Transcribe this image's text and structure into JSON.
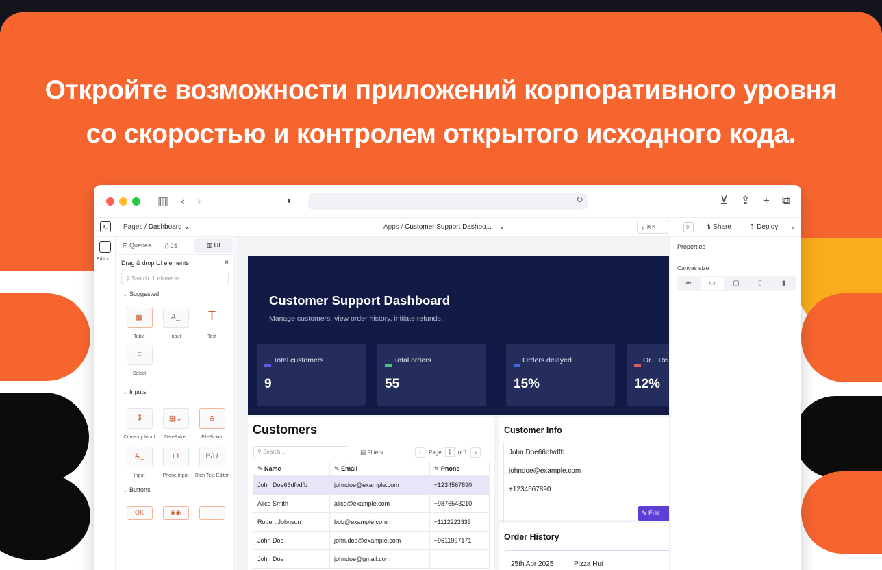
{
  "headline": {
    "line1": "Откройте возможности приложений корпоративного уровня",
    "line2": "со скоростью и контролем открытого исходного кода."
  },
  "colors": {
    "brand_orange": "#f7652f",
    "accent_purple": "#5b3fd6",
    "hero_navy": "#121a46"
  },
  "appbar": {
    "logo": "a_",
    "pages_prefix": "Pages /",
    "pages_current": "Dashboard ⌄",
    "apps_prefix": "Apps /",
    "app_name": "Customer Support Dashbo...",
    "app_chevron": "⌄",
    "search_shortcut": "⌘K",
    "run": "▷",
    "share": "Share",
    "deploy": "Deploy",
    "deploy_chevron": "⌄"
  },
  "rail": {
    "editor_label": "Editor"
  },
  "panel": {
    "tabs": {
      "queries": "Queries",
      "js": "JS",
      "ui": "UI"
    },
    "title": "Drag & drop UI elements",
    "close": "×",
    "search_placeholder": "Search UI elements",
    "sections": {
      "suggested": "Suggested",
      "inputs": "Inputs",
      "buttons": "Buttons"
    },
    "suggested": [
      {
        "label": "Table",
        "glyph": "▦"
      },
      {
        "label": "Input",
        "glyph": "A_"
      },
      {
        "label": "Text",
        "glyph": "T"
      }
    ],
    "suggested2": [
      {
        "label": "Select",
        "glyph": "≡"
      }
    ],
    "inputs": [
      {
        "label": "Currency Input",
        "glyph": "$"
      },
      {
        "label": "DatePaker",
        "glyph": "▦⌄"
      },
      {
        "label": "FilePicker",
        "glyph": "⊕"
      }
    ],
    "inputs2": [
      {
        "label": "Input",
        "glyph": "A_"
      },
      {
        "label": "Phone Input",
        "glyph": "+1"
      },
      {
        "label": "Rich Text Editor",
        "glyph": "B/U"
      }
    ],
    "buttons": [
      {
        "glyph": "OK"
      },
      {
        "glyph": "◉◉"
      },
      {
        "glyph": "+"
      }
    ]
  },
  "hero": {
    "title": "Customer Support Dashboard",
    "subtitle": "Manage customers, view order history, initiate refunds.",
    "stats": [
      {
        "label": "Total customers",
        "value": "9",
        "color": "#6a55e8"
      },
      {
        "label": "Total orders",
        "value": "55",
        "color": "#4ec27a"
      },
      {
        "label": "Orders delayed",
        "value": "15%",
        "color": "#3b6de0"
      },
      {
        "label": "Or... Re...",
        "value": "12%",
        "color": "#e25a6a"
      }
    ]
  },
  "customers": {
    "title": "Customers",
    "search_placeholder": "Search...",
    "filters": "Filters",
    "page_label": "Page",
    "page_current": "1",
    "page_of": "of 1",
    "columns": [
      "Name",
      "Email",
      "Phone"
    ],
    "rows": [
      [
        "John Doe66dfvdfb",
        "johndoe@example.com",
        "+1234567890"
      ],
      [
        "Alice Smith",
        "alice@example.com",
        "+9876543210"
      ],
      [
        "Robert Johnson",
        "bob@example.com",
        "+1112223333"
      ],
      [
        "John Doe",
        "john.doe@example.com",
        "+9611997171"
      ],
      [
        "John Doe",
        "johndoe@gmail.com",
        ""
      ]
    ]
  },
  "customer_info": {
    "title": "Customer Info",
    "name": "John Doe66dfvdfb",
    "email": "johndoe@example.com",
    "phone": "+1234567890",
    "edit": "Edit"
  },
  "order_history": {
    "title": "Order History",
    "first_date": "25th Apr 2025",
    "first_vendor": "Pizza Hut"
  },
  "properties": {
    "title": "Properties",
    "canvas_size": "Canvas size"
  }
}
